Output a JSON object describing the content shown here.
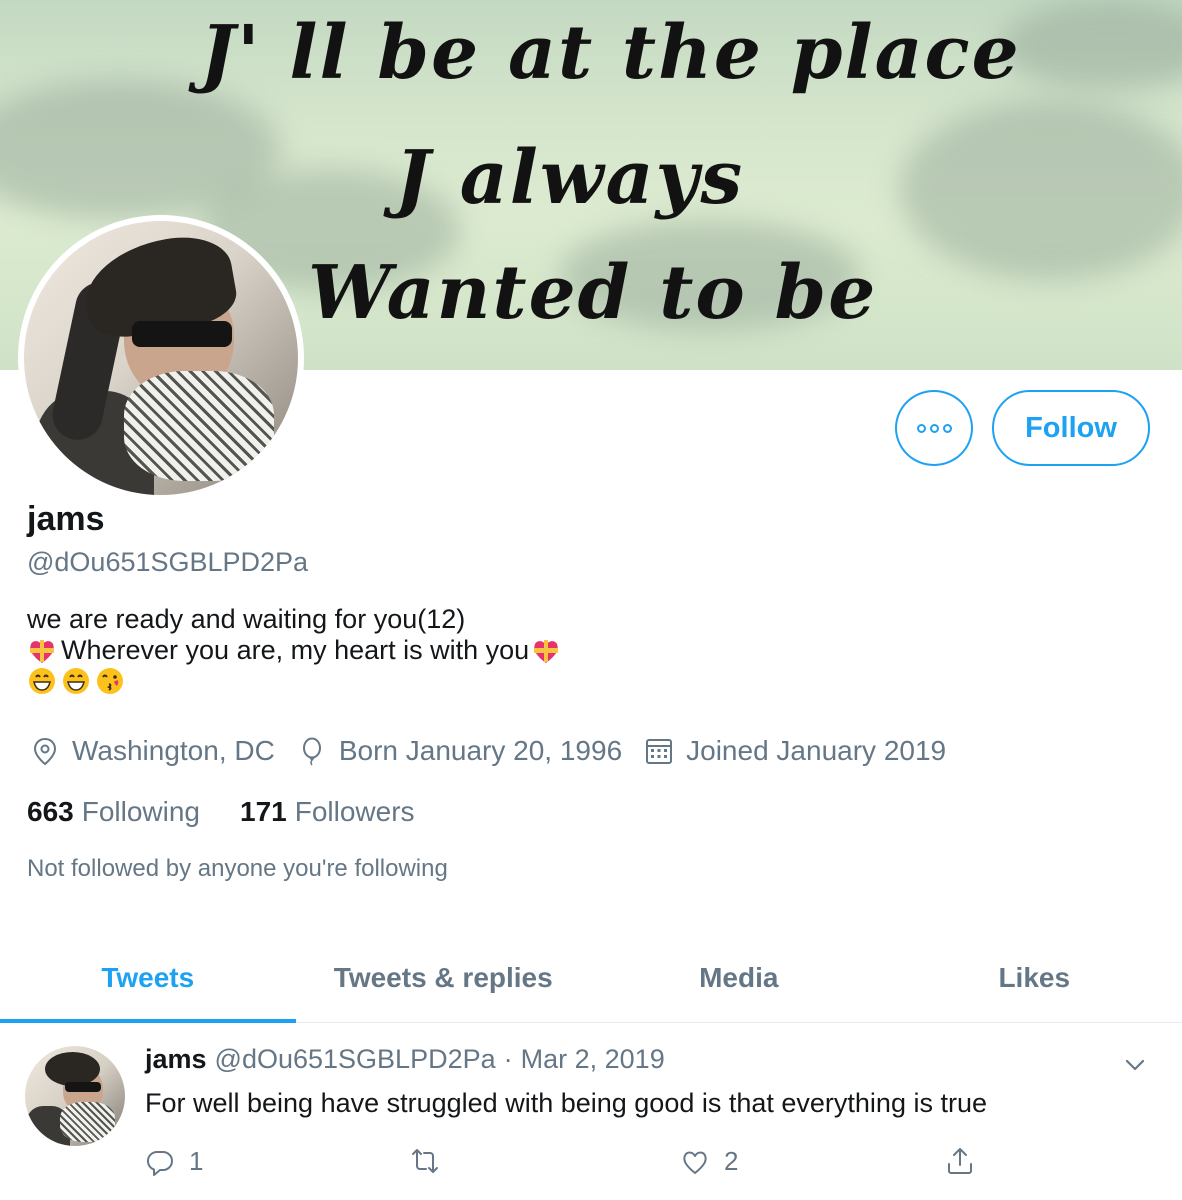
{
  "banner": {
    "line1": "J' ll be at the place",
    "line2": "J always",
    "line3": "Wanted to be"
  },
  "actions": {
    "more_icon": "more-dots-icon",
    "follow_label": "Follow"
  },
  "profile": {
    "name": "jams",
    "handle": "@dOu651SGBLPD2Pa",
    "bio_line1": "we are ready and waiting for you(12)",
    "bio_line2": "Wherever you are, my heart is with you",
    "location": "Washington, DC",
    "born": "Born January 20, 1996",
    "joined": "Joined January 2019",
    "following_count": "663",
    "following_label": "Following",
    "followers_count": "171",
    "followers_label": "Followers",
    "not_followed": "Not followed by anyone you're following"
  },
  "tabs": [
    {
      "label": "Tweets",
      "active": true
    },
    {
      "label": "Tweets & replies",
      "active": false
    },
    {
      "label": "Media",
      "active": false
    },
    {
      "label": "Likes",
      "active": false
    }
  ],
  "tweet": {
    "name": "jams",
    "handle": "@dOu651SGBLPD2Pa",
    "separator": "·",
    "date": "Mar 2, 2019",
    "text": "For well being have struggled with being good is that everything is true",
    "reply_count": "1",
    "retweet_count": "",
    "like_count": "2"
  },
  "colors": {
    "accent": "#1da1f2",
    "secondary_text": "#657786",
    "primary_text": "#14171a"
  }
}
